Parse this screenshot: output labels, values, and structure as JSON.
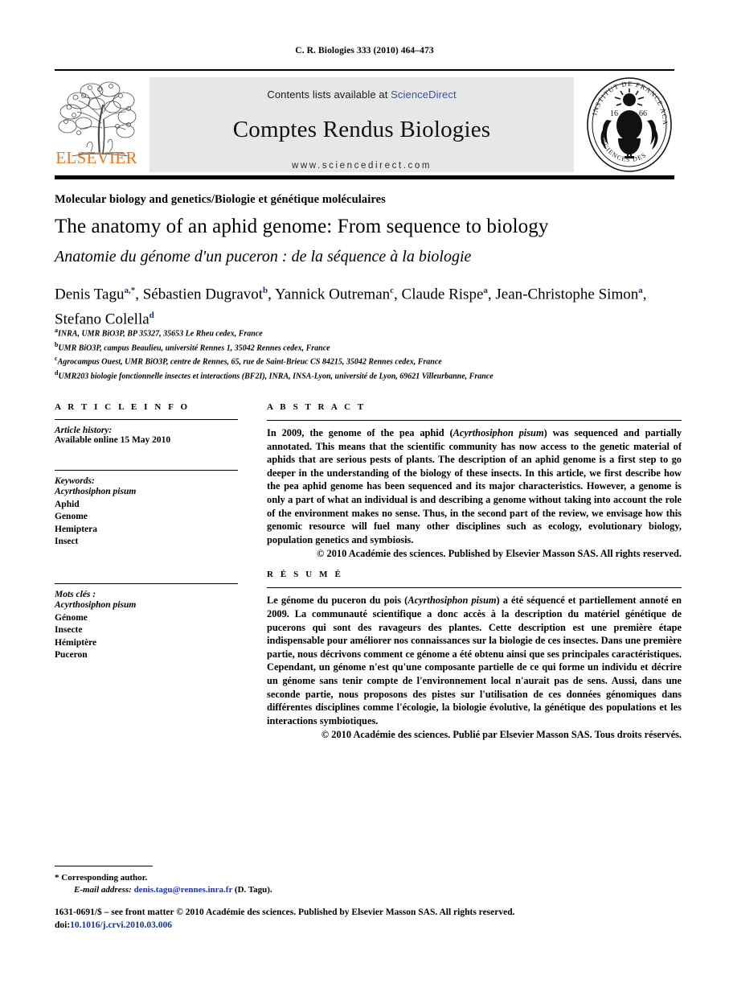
{
  "running_head": "C. R. Biologies 333 (2010) 464–473",
  "masthead": {
    "publisher_logo_name": "elsevier-tree-logo",
    "publisher_wordmark": "ELSEVIER",
    "publisher_color": "#E87722",
    "contents_prefix": "Contents lists available at ",
    "contents_link": "ScienceDirect",
    "contents_link_color": "#3b4fa0",
    "journal_title": "Comptes Rendus Biologies",
    "journal_url": "www.sciencedirect.com",
    "banner_color": "#e6e7e8",
    "seal_name": "academie-des-sciences-seal",
    "seal_outer_text": "INSTITUT DE FRANCE · ACADÉMIE DES SCIENCES",
    "seal_year": "1666"
  },
  "article": {
    "section": "Molecular biology and genetics/Biologie et génétique moléculaires",
    "title_en": "The anatomy of an aphid genome: From sequence to biology",
    "title_fr": "Anatomie du génome d'un puceron : de la séquence à la biologie",
    "authors": [
      {
        "name": "Denis Tagu",
        "marks": "a,*",
        "sep": ", "
      },
      {
        "name": "Sébastien Dugravot",
        "marks": "b",
        "sep": ", "
      },
      {
        "name": "Yannick Outreman",
        "marks": "c",
        "sep": ", "
      },
      {
        "name": "Claude Rispe",
        "marks": "a",
        "sep": ", "
      },
      {
        "name": "Jean-Christophe Simon",
        "marks": "a",
        "sep": ", "
      },
      {
        "name": "Stefano Colella",
        "marks": "d",
        "sep": ""
      }
    ],
    "affiliations": [
      {
        "mark": "a",
        "text": "INRA, UMR BiO3P, BP 35327, 35653 Le Rheu cedex, France"
      },
      {
        "mark": "b",
        "text": "UMR BiO3P, campus Beaulieu, université Rennes 1, 35042 Rennes cedex, France"
      },
      {
        "mark": "c",
        "text": "Agrocampus Ouest, UMR BiO3P, centre de Rennes, 65, rue de Saint-Brieuc CS 84215, 35042 Rennes cedex, France"
      },
      {
        "mark": "d",
        "text": "UMR203 biologie fonctionnelle insectes et interactions (BF2I), INRA, INSA-Lyon, université de Lyon, 69621 Villeurbanne, France"
      }
    ]
  },
  "info": {
    "heading": "A R T I C L E  I N F O",
    "history_label": "Article history:",
    "history_value": "Available online 15 May 2010",
    "keywords_label": "Keywords:",
    "keywords": [
      "Acyrthosiphon pisum",
      "Aphid",
      "Genome",
      "Hemiptera",
      "Insect"
    ],
    "keywords_italic_count": 1,
    "motscles_label": "Mots clés :",
    "motscles": [
      "Acyrthosiphon pisum",
      "Génome",
      "Insecte",
      "Hémiptère",
      "Puceron"
    ],
    "motscles_italic_count": 1
  },
  "abstract": {
    "heading": "A B S T R A C T",
    "part1": "In 2009, the genome of the pea aphid (",
    "species": "Acyrthosiphon pisum",
    "part2": ") was sequenced and partially annotated. This means that the scientific community has now access to the genetic material of aphids that are serious pests of plants. The description of an aphid genome is a first step to go deeper in the understanding of the biology of these insects. In this article, we first describe how the pea aphid genome has been sequenced and its major characteristics. However, a genome is only a part of what an individual is and describing a genome without taking into account the role of the environment makes no sense. Thus, in the second part of the review, we envisage how this genomic resource will fuel many other disciplines such as ecology, evolutionary biology, population genetics and symbiosis.",
    "copyright": "© 2010 Académie des sciences. Published by Elsevier Masson SAS. All rights reserved."
  },
  "resume": {
    "heading": "R É S U M É",
    "part1": "Le génome du puceron du pois (",
    "species": "Acyrthosiphon pisum",
    "part2": ") a été séquencé et partiellement annoté en 2009. La communauté scientifique a donc accès à la description du matériel génétique de pucerons qui sont des ravageurs des plantes. Cette description est une première étape indispensable pour améliorer nos connaissances sur la biologie de ces insectes. Dans une première partie, nous décrivons comment ce génome a été obtenu ainsi que ses principales caractéristiques. Cependant, un génome n'est qu'une composante partielle de ce qui forme un individu et décrire un génome sans tenir compte de l'environnement local n'aurait pas de sens. Aussi, dans une seconde partie, nous proposons des pistes sur l'utilisation de ces données génomiques dans différentes disciplines comme l'écologie, la biologie évolutive, la génétique des populations et les interactions symbiotiques.",
    "copyright": "© 2010 Académie des sciences. Publié par Elsevier Masson SAS. Tous droits réservés."
  },
  "footnotes": {
    "star": "*",
    "corresponding": "Corresponding author.",
    "email_label": "E-mail address:",
    "email": "denis.tagu@rennes.inra.fr",
    "email_owner": "(D. Tagu)."
  },
  "imprint": {
    "line1": "1631-0691/$ – see front matter © 2010 Académie des sciences. Published by Elsevier Masson SAS. All rights reserved.",
    "doi_label": "doi:",
    "doi": "10.1016/j.crvi.2010.03.006"
  }
}
